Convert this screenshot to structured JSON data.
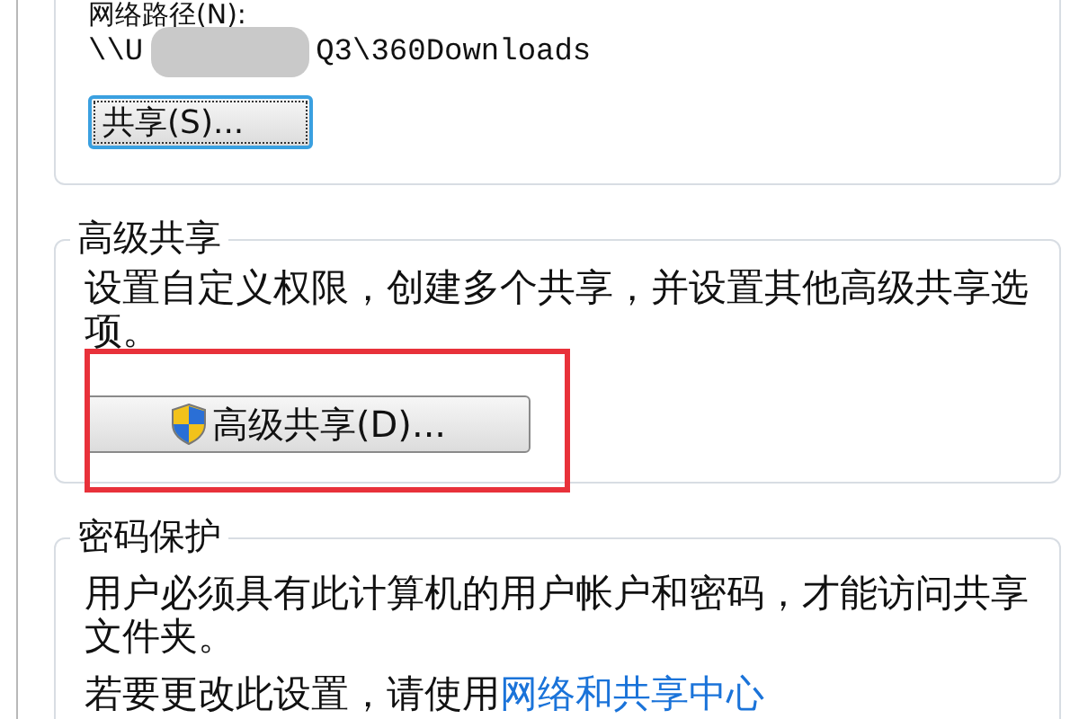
{
  "network_path": {
    "label": "网络路径(N):",
    "path_start": "\\\\U",
    "path_end": "Q3\\360Downloads",
    "path_blurred": true
  },
  "share_button": {
    "label": "共享(S)...",
    "focused": true
  },
  "advanced_sharing": {
    "title": "高级共享",
    "description": "设置自定义权限，创建多个共享，并设置其他高级共享选项。",
    "button": "高级共享(D)...",
    "highlighted": true
  },
  "password_protection": {
    "title": "密码保护",
    "description": "用户必须具有此计算机的用户帐户和密码，才能访问共享文件夹。",
    "hint": "若要更改此设置，请使用",
    "link": "网络和共享中心"
  }
}
